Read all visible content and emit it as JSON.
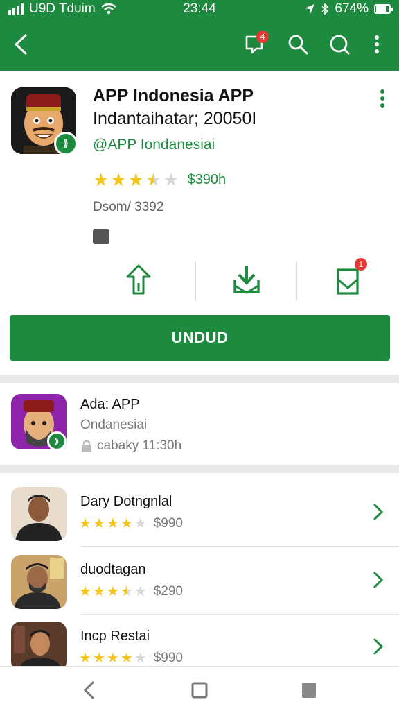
{
  "status_bar": {
    "carrier": "U9D Tduim",
    "time": "23:44",
    "battery": "674%"
  },
  "toolbar": {
    "notification_count": "4"
  },
  "app": {
    "title": "APP Indonesia APP",
    "subtitle": "Indantaihatar; 20050I",
    "developer": "@APP Iondanesiai",
    "rating": 3.5,
    "price": "$390h",
    "downloads": "Dsom/ 3392",
    "verified_mark": "⟫"
  },
  "actions": {
    "third_badge": "1"
  },
  "install_label": "UNDUD",
  "featured": {
    "title": "Ada: APP",
    "developer": "Ondanesiai",
    "time": "cabaky 11:30h"
  },
  "list": [
    {
      "name": "Dary Dotngnlal",
      "rating": 4,
      "price": "$990"
    },
    {
      "name": "duodtagan",
      "rating": 3.5,
      "price": "$290"
    },
    {
      "name": "Incp Restai",
      "rating": 4,
      "price": "$990"
    }
  ],
  "colors": {
    "brand_green": "#1e8a3f",
    "star_gold": "#f5c518",
    "badge_red": "#e53935"
  },
  "icons": [
    "back-arrow-icon",
    "notification-icon",
    "search-icon",
    "search-alt-icon",
    "more-vert-icon",
    "share-icon",
    "download-icon",
    "bookmark-icon",
    "lock-icon",
    "chevron-right-icon",
    "nav-back-icon",
    "nav-home-icon",
    "nav-recent-icon"
  ]
}
